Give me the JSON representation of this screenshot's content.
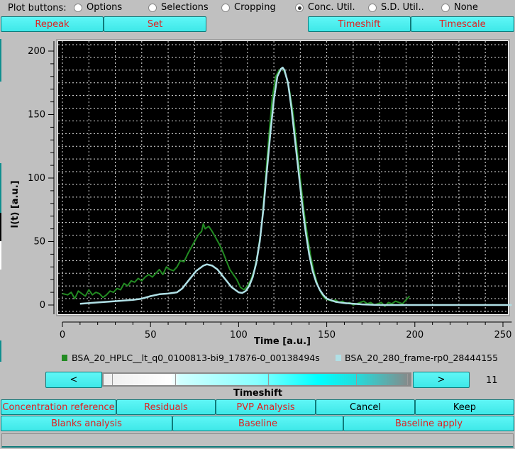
{
  "radio_group": {
    "label": "Plot buttons:",
    "options": [
      {
        "label": "Options",
        "selected": false
      },
      {
        "label": "Selections",
        "selected": false
      },
      {
        "label": "Cropping",
        "selected": false
      },
      {
        "label": "Conc. Util.",
        "selected": true
      },
      {
        "label": "S.D. Util..",
        "selected": false
      },
      {
        "label": "None",
        "selected": false
      }
    ]
  },
  "top_buttons": {
    "repeak": "Repeak",
    "set": "Set",
    "timeshift": "Timeshift",
    "timescale": "Timescale"
  },
  "slider": {
    "prev_label": "<",
    "next_label": ">",
    "caption": "Timeshift",
    "value": "11"
  },
  "bottom_buttons": {
    "row1": [
      "Concentration reference",
      "Residuals",
      "PVP Analysis",
      "Cancel",
      "Keep"
    ],
    "row2": [
      "Blanks analysis",
      "Baseline",
      "Baseline apply"
    ]
  },
  "colors": {
    "series1": "#228b22",
    "series2": "#b0e0e6",
    "button_bg": "#4cf0f0",
    "button_text": "#e02020"
  },
  "chart_data": {
    "type": "line",
    "title": "",
    "xlabel": "Time [a.u.]",
    "ylabel": "I(t) [a.u.]",
    "xlim": [
      0,
      255
    ],
    "ylim": [
      -5,
      205
    ],
    "xticks": [
      0,
      50,
      100,
      150,
      200,
      250
    ],
    "yticks": [
      0,
      50,
      100,
      150,
      200
    ],
    "grid": true,
    "legend_position": "bottom",
    "series": [
      {
        "name": "BSA_20_HPLC__lt_q0_0100813-bi9_17876-0_00138494s",
        "color": "#228b22",
        "x": [
          0,
          3,
          5,
          7,
          9,
          11,
          13,
          15,
          17,
          19,
          21,
          23,
          25,
          27,
          29,
          31,
          33,
          35,
          37,
          39,
          41,
          43,
          45,
          47,
          49,
          51,
          53,
          55,
          57,
          59,
          61,
          63,
          65,
          67,
          69,
          71,
          73,
          75,
          77,
          79,
          80,
          81,
          83,
          85,
          87,
          89,
          91,
          93,
          95,
          97,
          99,
          101,
          103,
          105,
          107,
          109,
          111,
          113,
          115,
          117,
          119,
          121,
          123,
          125,
          127,
          129,
          131,
          133,
          135,
          137,
          139,
          141,
          143,
          145,
          147,
          149,
          151,
          153,
          155,
          157,
          159,
          161,
          163,
          165,
          167,
          169,
          171,
          173,
          175,
          177,
          179,
          181,
          183,
          185,
          187,
          189,
          191,
          193,
          195,
          197
        ],
        "y": [
          9,
          8,
          10,
          5,
          11,
          9,
          7,
          12,
          8,
          10,
          9,
          6,
          8,
          11,
          10,
          13,
          12,
          17,
          15,
          19,
          18,
          21,
          19,
          22,
          24,
          22,
          25,
          28,
          24,
          30,
          28,
          27,
          30,
          35,
          34,
          40,
          45,
          50,
          55,
          58,
          64,
          60,
          62,
          58,
          53,
          48,
          42,
          35,
          28,
          24,
          20,
          14,
          12,
          15,
          20,
          28,
          42,
          62,
          95,
          130,
          162,
          180,
          185,
          187,
          180,
          168,
          150,
          125,
          100,
          75,
          55,
          38,
          25,
          15,
          9,
          5,
          4,
          3,
          4,
          2,
          3,
          1,
          2,
          0,
          1,
          2,
          3,
          1,
          2,
          0,
          1,
          2,
          -1,
          2,
          1,
          3,
          2,
          1,
          4,
          7
        ]
      },
      {
        "name": "BSA_20_280_frame-rp0_28444155",
        "color": "#b0e0e6",
        "x": [
          10,
          20,
          30,
          40,
          45,
          50,
          55,
          60,
          65,
          68,
          72,
          76,
          80,
          82,
          85,
          88,
          92,
          96,
          100,
          102,
          104,
          106,
          108,
          110,
          112,
          114,
          116,
          118,
          120,
          122,
          124,
          125,
          126,
          128,
          130,
          132,
          134,
          136,
          138,
          140,
          142,
          144,
          146,
          148,
          150,
          155,
          160,
          170,
          180,
          200,
          220,
          255
        ],
        "y": [
          1,
          2,
          3,
          4,
          5,
          7,
          8.5,
          9,
          10,
          13,
          20,
          27,
          31,
          32,
          31,
          28,
          21,
          14,
          10,
          9.5,
          11,
          15,
          22,
          33,
          50,
          75,
          105,
          135,
          162,
          180,
          186,
          187,
          185,
          175,
          155,
          130,
          105,
          80,
          58,
          40,
          27,
          18,
          12,
          8,
          5,
          2.5,
          1.5,
          0.5,
          0,
          0,
          0,
          0
        ]
      }
    ]
  }
}
